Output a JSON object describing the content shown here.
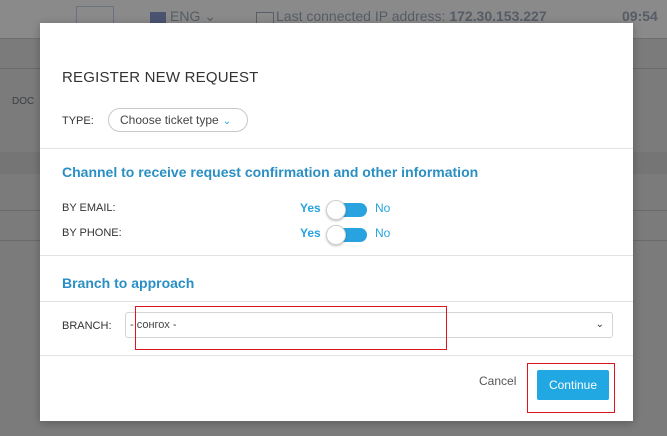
{
  "background": {
    "logo_text": "",
    "language": "ENG",
    "ip_prefix": "Last connected IP address:",
    "ip_value": "172.30.153.227",
    "time": "09:54",
    "side_text": "DOC"
  },
  "modal": {
    "title": "REGISTER NEW REQUEST",
    "type_label": "TYPE:",
    "type_placeholder": "Choose ticket type",
    "channel_section_title": "Channel to receive request confirmation and other information",
    "channels": [
      {
        "label": "BY EMAIL:",
        "yes": "Yes",
        "no": "No",
        "state": "Yes"
      },
      {
        "label": "BY PHONE:",
        "yes": "Yes",
        "no": "No",
        "state": "Yes"
      }
    ],
    "branch_section_title": "Branch to approach",
    "branch_label": "BRANCH:",
    "branch_value": "- сонгох -",
    "cancel_label": "Cancel",
    "continue_label": "Continue"
  },
  "colors": {
    "accent": "#29a3df",
    "section_title": "#2a8fc4",
    "button": "#21a7e2",
    "highlight": "#e0141b",
    "overlay": "#7b7b7b"
  }
}
